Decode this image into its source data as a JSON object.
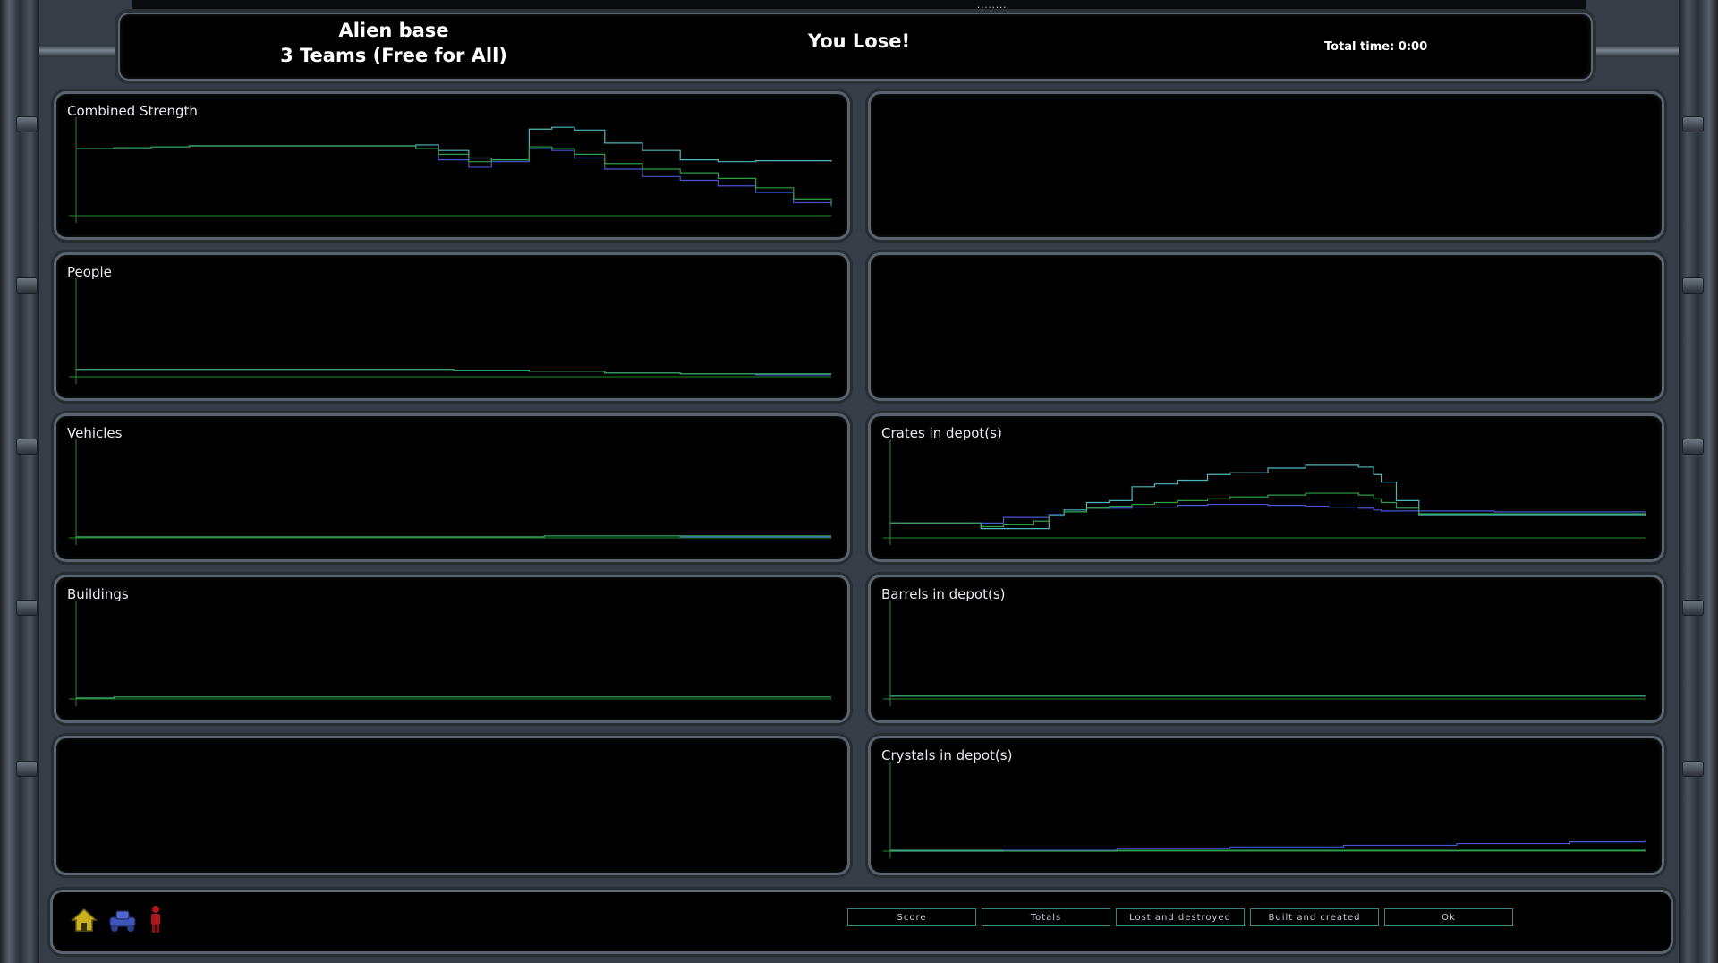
{
  "header": {
    "map_name": "Alien base",
    "mode": "3 Teams (Free for All)",
    "result": "You Lose!",
    "total_time": "Total time: 0:00",
    "top_handle": "........"
  },
  "colors": {
    "team_cyan": "#4fc3c8",
    "team_blue": "#4a5be0",
    "team_green": "#2fa64a",
    "axis": "#1f8a2a",
    "button_border": "#2f8a86"
  },
  "panels": {
    "combined_strength": {
      "title": "Combined Strength"
    },
    "people": {
      "title": "People"
    },
    "vehicles": {
      "title": "Vehicles"
    },
    "buildings": {
      "title": "Buildings"
    },
    "crates": {
      "title": "Crates in depot(s)"
    },
    "barrels": {
      "title": "Barrels in depot(s)"
    },
    "crystals": {
      "title": "Crystals in depot(s)"
    }
  },
  "chart_data": [
    {
      "id": "combined_strength",
      "type": "line",
      "title": "Combined Strength",
      "xlabel": "",
      "ylabel": "",
      "ylim": [
        0,
        100
      ],
      "x": [
        0,
        5,
        10,
        15,
        20,
        25,
        30,
        35,
        40,
        45,
        48,
        52,
        55,
        60,
        63,
        66,
        70,
        75,
        80,
        85,
        90,
        95,
        100
      ],
      "series": [
        {
          "color": "#4fc3c8",
          "values": [
            72,
            73,
            74,
            75,
            75,
            75,
            75,
            75,
            75,
            76,
            70,
            62,
            60,
            93,
            95,
            92,
            78,
            70,
            60,
            58,
            59,
            59,
            58
          ]
        },
        {
          "color": "#4a5be0",
          "values": [
            72,
            73,
            74,
            75,
            75,
            75,
            75,
            75,
            75,
            72,
            60,
            52,
            58,
            72,
            70,
            62,
            50,
            42,
            38,
            32,
            25,
            14,
            10
          ]
        },
        {
          "color": "#2fa64a",
          "values": [
            72,
            73,
            74,
            75,
            75,
            75,
            75,
            75,
            75,
            72,
            66,
            58,
            60,
            74,
            72,
            66,
            56,
            50,
            46,
            40,
            30,
            18,
            12
          ]
        }
      ]
    },
    {
      "id": "people",
      "type": "line",
      "title": "People",
      "xlabel": "",
      "ylabel": "",
      "ylim": [
        0,
        100
      ],
      "x": [
        0,
        20,
        40,
        50,
        60,
        70,
        80,
        90,
        100
      ],
      "series": [
        {
          "color": "#4fc3c8",
          "values": [
            8,
            8,
            8,
            7,
            6,
            4,
            3,
            3,
            3
          ]
        },
        {
          "color": "#4a5be0",
          "values": [
            8,
            8,
            8,
            7,
            6,
            4,
            3,
            2,
            2
          ]
        },
        {
          "color": "#2fa64a",
          "values": [
            8,
            8,
            8,
            7,
            6,
            4,
            3,
            3,
            3
          ]
        }
      ]
    },
    {
      "id": "vehicles",
      "type": "line",
      "title": "Vehicles",
      "xlabel": "",
      "ylabel": "",
      "ylim": [
        0,
        100
      ],
      "x": [
        0,
        20,
        40,
        58,
        62,
        70,
        80,
        90,
        100
      ],
      "series": [
        {
          "color": "#4fc3c8",
          "values": [
            1,
            1,
            1,
            1,
            2,
            2,
            2,
            2,
            2
          ]
        },
        {
          "color": "#4a5be0",
          "values": [
            1,
            1,
            1,
            1,
            2,
            2,
            1,
            1,
            1
          ]
        },
        {
          "color": "#2fa64a",
          "values": [
            1,
            1,
            1,
            1,
            2,
            2,
            2,
            2,
            2
          ]
        }
      ]
    },
    {
      "id": "buildings",
      "type": "line",
      "title": "Buildings",
      "xlabel": "",
      "ylabel": "",
      "ylim": [
        0,
        100
      ],
      "x": [
        0,
        5,
        50,
        100
      ],
      "series": [
        {
          "color": "#4fc3c8",
          "values": [
            1,
            2,
            2,
            2
          ]
        },
        {
          "color": "#4a5be0",
          "values": [
            1,
            2,
            2,
            2
          ]
        },
        {
          "color": "#2fa64a",
          "values": [
            1,
            2,
            2,
            2
          ]
        }
      ]
    },
    {
      "id": "crates",
      "type": "line",
      "title": "Crates in depot(s)",
      "xlabel": "",
      "ylabel": "",
      "ylim": [
        0,
        100
      ],
      "x": [
        0,
        10,
        12,
        15,
        19,
        21,
        23,
        26,
        29,
        32,
        35,
        38,
        42,
        45,
        50,
        55,
        58,
        62,
        64,
        65,
        67,
        70,
        75,
        80,
        90,
        100
      ],
      "series": [
        {
          "color": "#4fc3c8",
          "values": [
            16,
            16,
            10,
            10,
            10,
            25,
            30,
            38,
            40,
            55,
            58,
            62,
            68,
            70,
            75,
            78,
            78,
            76,
            68,
            60,
            40,
            25,
            25,
            25,
            25,
            25
          ]
        },
        {
          "color": "#4a5be0",
          "values": [
            16,
            16,
            16,
            22,
            22,
            25,
            28,
            32,
            32,
            33,
            33,
            35,
            36,
            36,
            35,
            34,
            33,
            32,
            30,
            29,
            29,
            29,
            29,
            28,
            28,
            28
          ]
        },
        {
          "color": "#2fa64a",
          "values": [
            16,
            16,
            12,
            14,
            18,
            24,
            28,
            32,
            34,
            36,
            38,
            40,
            42,
            44,
            46,
            48,
            48,
            46,
            42,
            38,
            32,
            26,
            26,
            26,
            26,
            26
          ]
        }
      ]
    },
    {
      "id": "barrels",
      "type": "line",
      "title": "Barrels in depot(s)",
      "xlabel": "",
      "ylabel": "",
      "ylim": [
        0,
        100
      ],
      "x": [
        0,
        50,
        100
      ],
      "series": [
        {
          "color": "#4fc3c8",
          "values": [
            3,
            3,
            3
          ]
        },
        {
          "color": "#4a5be0",
          "values": [
            3,
            3,
            3
          ]
        },
        {
          "color": "#2fa64a",
          "values": [
            3,
            3,
            3
          ]
        }
      ]
    },
    {
      "id": "crystals",
      "type": "line",
      "title": "Crystals in depot(s)",
      "xlabel": "",
      "ylabel": "",
      "ylim": [
        0,
        100
      ],
      "x": [
        0,
        15,
        30,
        45,
        60,
        75,
        90,
        100
      ],
      "series": [
        {
          "color": "#4fc3c8",
          "values": [
            1,
            1,
            1,
            1,
            1,
            1,
            1,
            1
          ]
        },
        {
          "color": "#4a5be0",
          "values": [
            0,
            1,
            3,
            5,
            7,
            9,
            11,
            13
          ]
        },
        {
          "color": "#2fa64a",
          "values": [
            0,
            0,
            1,
            1,
            1,
            1,
            1,
            1
          ]
        }
      ]
    }
  ],
  "footer": {
    "team_icons": [
      "house-icon",
      "vehicle-icon",
      "person-icon"
    ],
    "buttons": {
      "score": "Score",
      "totals": "Totals",
      "lost_destroyed": "Lost and destroyed",
      "built_created": "Built and created",
      "ok": "Ok"
    }
  }
}
